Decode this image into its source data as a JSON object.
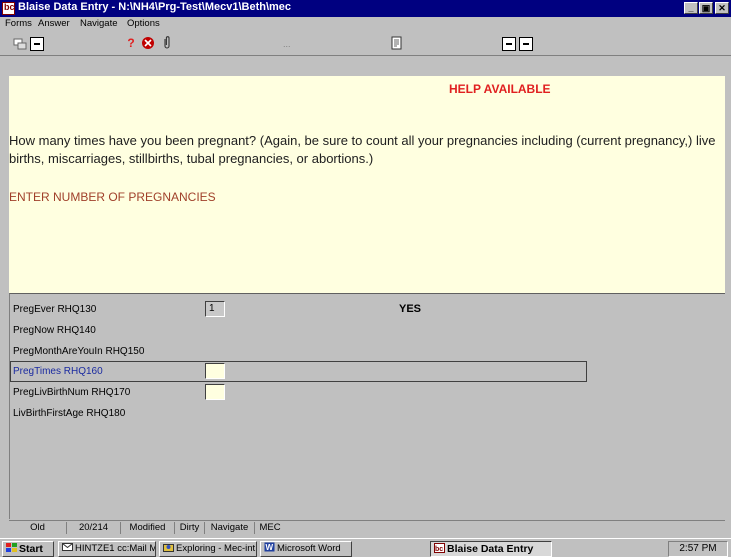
{
  "window": {
    "title": "Blaise Data Entry - N:\\NH4\\Prg-Test\\Mecv1\\Beth\\mec",
    "controls": [
      "_",
      "▣",
      "✕"
    ]
  },
  "menu": {
    "forms": "Forms",
    "answer": "Answer",
    "navigate": "Navigate",
    "options": "Options"
  },
  "toolbar": {
    "help_icon": "?",
    "stop_icon": "✆",
    "attach_icon": "🖇",
    "ellipsis": "...",
    "doc_icon": "🗎"
  },
  "question": {
    "help_available": "HELP AVAILABLE",
    "text": "How many times have you been pregnant? (Again, be  sure to count all your pregnancies including (current pregnancy,) live births, miscarriages, stillbirths, tubal pregnancies, or abortions.)",
    "instruction": "ENTER NUMBER OF PREGNANCIES"
  },
  "fields": [
    {
      "label": "PregEver RHQ130",
      "value": "1",
      "answer": "YES"
    },
    {
      "label": "PregNow RHQ140"
    },
    {
      "label": "PregMonthAreYouIn RHQ150"
    },
    {
      "label": "PregTimes RHQ160",
      "value": ""
    },
    {
      "label": "PregLivBirthNum RHQ170",
      "value": ""
    },
    {
      "label": "LivBirthFirstAge RHQ180"
    }
  ],
  "status": {
    "mode": "Old",
    "position": "20/214",
    "modified": "Modified",
    "dirty": "Dirty",
    "navigate": "Navigate",
    "location": "MEC"
  },
  "taskbar": {
    "start": "Start",
    "tasks": [
      "HINTZE1 cc:Mail M...",
      "Exploring - Mec-int",
      "Microsoft Word",
      "Blaise Data Entry"
    ],
    "clock": "2:57 PM"
  },
  "colors": {
    "titlebar": "#000080",
    "question_bg": "#ffffe0",
    "help_red": "#e02020",
    "instruction": "#a0402a",
    "active_label": "#1a2aa0"
  }
}
